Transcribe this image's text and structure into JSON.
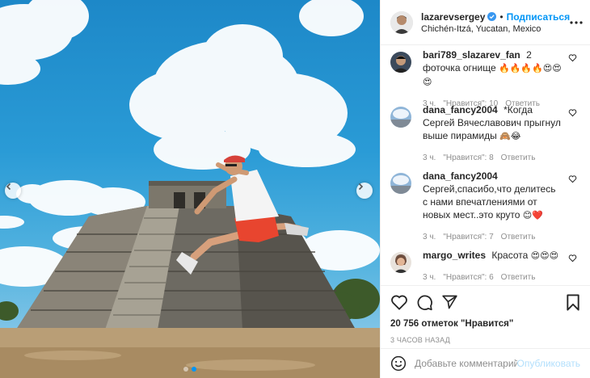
{
  "post": {
    "username": "lazarevsergey",
    "follow_label": "Подписаться",
    "bullet": "•",
    "location": "Chichén-Itzá, Yucatan, Mexico",
    "likes_text": "20 756 отметок \"Нравится\"",
    "time_ago": "3 ЧАСОВ НАЗАД",
    "slide_count": 2,
    "active_slide": 1
  },
  "comments": [
    {
      "user": "bari789_slazarev_fan",
      "text": "2 фоточка огнище",
      "emoji": "🔥🔥🔥🔥😍😍😍",
      "time": "3 ч.",
      "likes": "\"Нравится\": 10",
      "reply": "Ответить"
    },
    {
      "user": "dana_fancy2004",
      "text": "*Когда Сергей Вячеславович прыгнул выше пирамиды",
      "emoji": "🙈😂",
      "time": "3 ч.",
      "likes": "\"Нравится\": 8",
      "reply": "Ответить"
    },
    {
      "user": "dana_fancy2004",
      "text": "Сергей,спасибо,что делитесь с нами впечатлениями от новых мест..это круто",
      "emoji": "😊❤️",
      "time": "3 ч.",
      "likes": "\"Нравится\": 7",
      "reply": "Ответить"
    },
    {
      "user": "margo_writes",
      "text": "Красота",
      "emoji": "😍😍😍",
      "time": "3 ч.",
      "likes": "\"Нравится\": 6",
      "reply": "Ответить"
    }
  ],
  "composer": {
    "placeholder": "Добавьте комментарий...",
    "publish_label": "Опубликовать"
  },
  "colors": {
    "accent": "#0095f6",
    "publish_disabled": "#b2dffc",
    "verified": "#3897f0",
    "muted_text": "#8e8e8e"
  },
  "icons": {
    "like": "heart-icon",
    "comment": "comment-icon",
    "share": "paper-plane-icon",
    "save": "bookmark-icon",
    "more": "more-horizontal-icon",
    "emoji": "emoji-icon",
    "prev": "chevron-left-icon",
    "next": "chevron-right-icon"
  }
}
